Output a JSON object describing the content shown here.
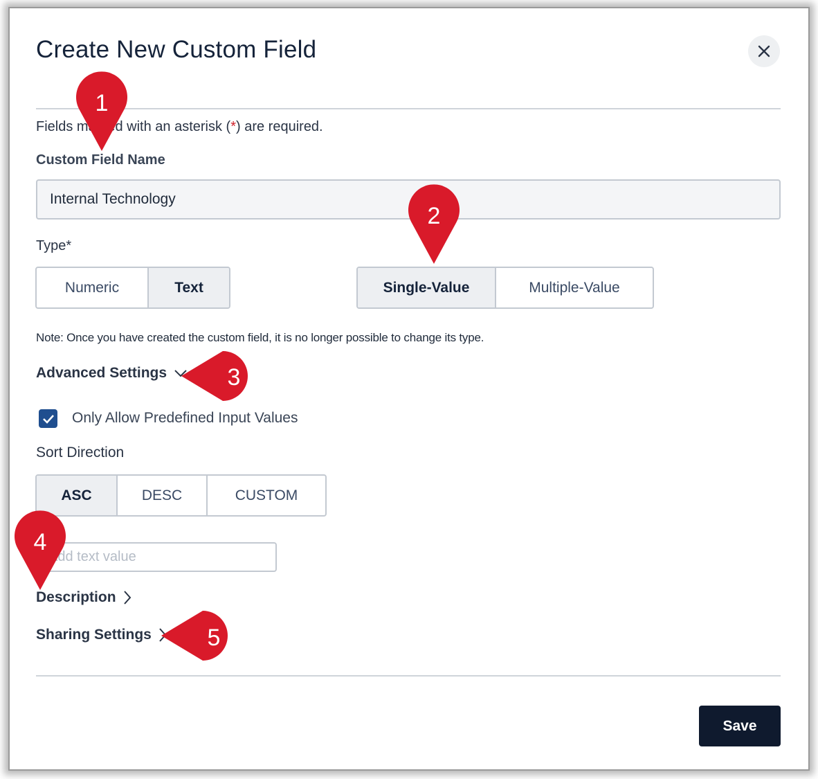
{
  "dialog": {
    "title": "Create New Custom Field",
    "required_note_before": "Fields marked with an asterisk (",
    "required_note_asterisk": "*",
    "required_note_after": ") are required."
  },
  "name_field": {
    "label": "Custom Field Name",
    "value": "Internal Technology"
  },
  "type_field": {
    "label": "Type*",
    "data_types": [
      {
        "label": "Numeric",
        "selected": false
      },
      {
        "label": "Text",
        "selected": true
      }
    ],
    "value_modes": [
      {
        "label": "Single-Value",
        "selected": true
      },
      {
        "label": "Multiple-Value",
        "selected": false
      }
    ],
    "note": "Note: Once you have created the custom field, it is no longer possible to change its type."
  },
  "advanced": {
    "label": "Advanced Settings",
    "checkbox_label": "Only Allow Predefined Input Values",
    "checkbox_checked": true,
    "sort_label": "Sort Direction",
    "sort_options": [
      {
        "label": "ASC",
        "selected": true
      },
      {
        "label": "DESC",
        "selected": false
      },
      {
        "label": "CUSTOM",
        "selected": false
      }
    ],
    "add_value_placeholder": "Add text value"
  },
  "description": {
    "label": "Description"
  },
  "sharing": {
    "label": "Sharing Settings"
  },
  "footer": {
    "save_label": "Save"
  },
  "callouts": [
    "1",
    "2",
    "3",
    "4",
    "5"
  ],
  "colors": {
    "callout_red": "#d91a2a",
    "save_bg": "#0f1a2e",
    "checkbox_blue": "#1f4e8f"
  }
}
